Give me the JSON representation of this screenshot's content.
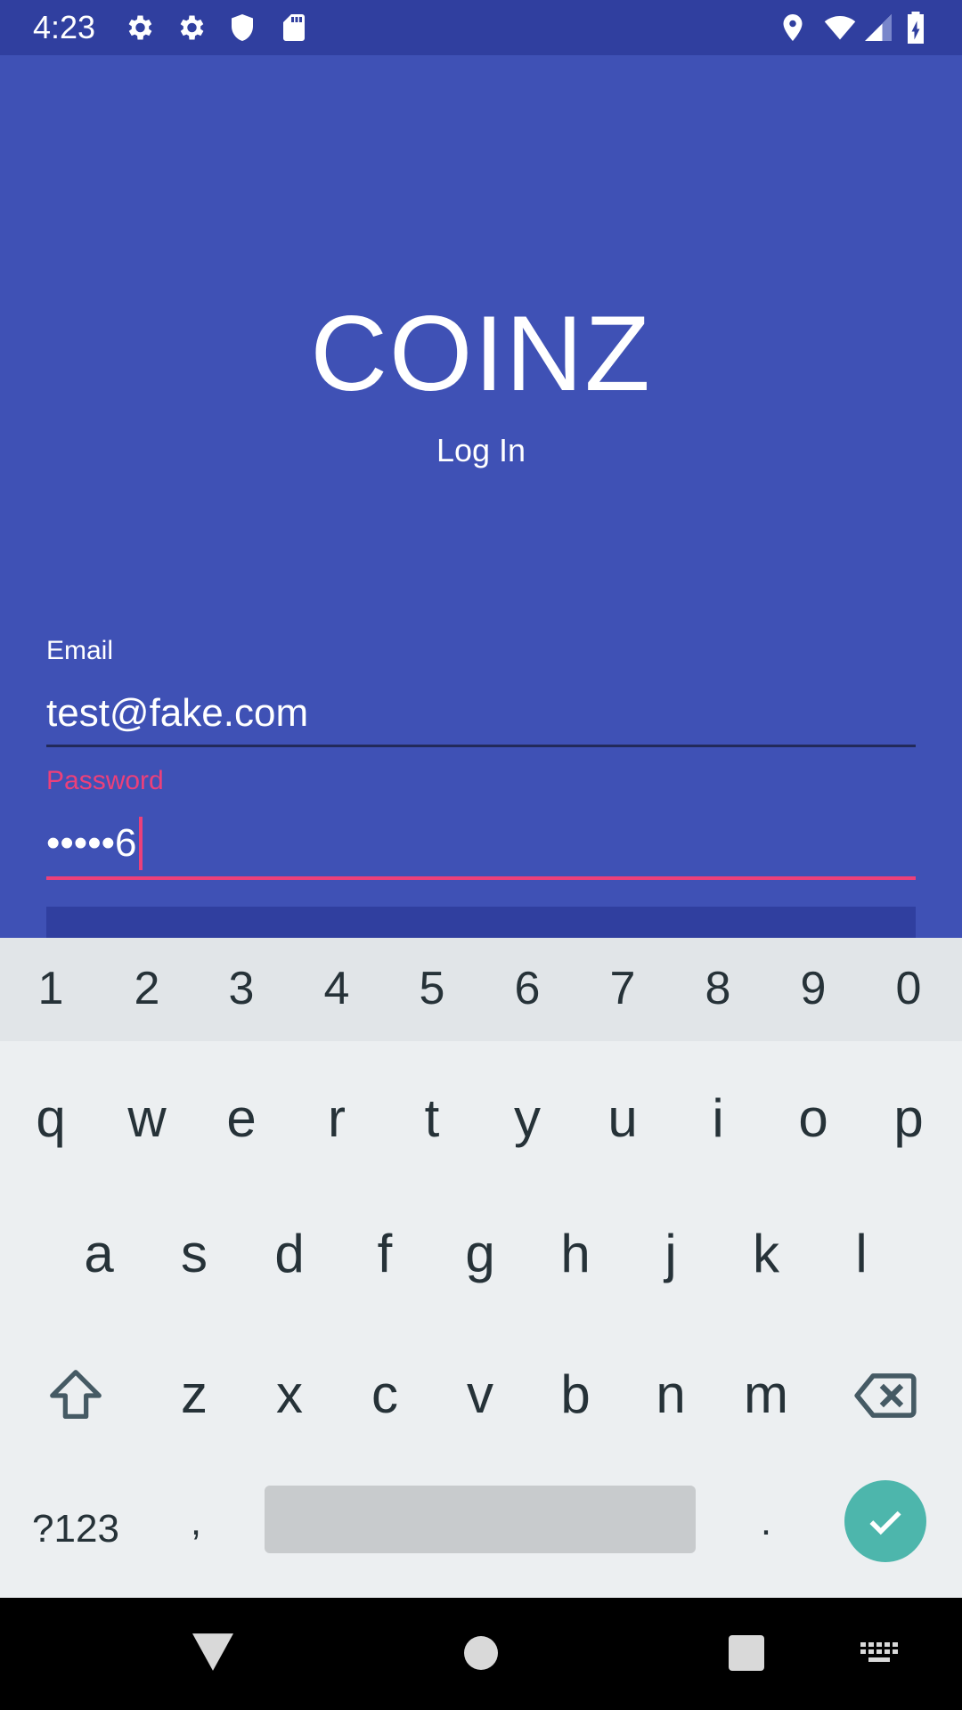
{
  "status_bar": {
    "time": "4:23",
    "left_icons": [
      "settings-icon",
      "settings-icon",
      "shield-icon",
      "sd-card-icon"
    ],
    "right_icons": [
      "location-icon",
      "wifi-icon",
      "cellular-signal-icon",
      "battery-charging-icon"
    ],
    "background": "#303f9f"
  },
  "app": {
    "title": "COINZ",
    "subtitle": "Log In",
    "background": "#3f51b5",
    "accent": "#ec407a"
  },
  "form": {
    "email": {
      "label": "Email",
      "value": "test@fake.com"
    },
    "password": {
      "label": "Password",
      "value": "•••••6"
    },
    "login_button": {
      "label": ""
    }
  },
  "keyboard": {
    "number_row": [
      "1",
      "2",
      "3",
      "4",
      "5",
      "6",
      "7",
      "8",
      "9",
      "0"
    ],
    "row1": [
      "q",
      "w",
      "e",
      "r",
      "t",
      "y",
      "u",
      "i",
      "o",
      "p"
    ],
    "row2": [
      "a",
      "s",
      "d",
      "f",
      "g",
      "h",
      "j",
      "k",
      "l"
    ],
    "row3": [
      "z",
      "x",
      "c",
      "v",
      "b",
      "n",
      "m"
    ],
    "symbols_label": "?123",
    "comma": ",",
    "period": ".",
    "shift_icon": "shift-icon",
    "backspace_icon": "backspace-icon",
    "enter_icon": "check-icon",
    "enter_color": "#4db6ac"
  },
  "nav_bar": {
    "icons": [
      "back-icon",
      "home-icon",
      "recents-icon",
      "keyboard-switch-icon"
    ]
  }
}
